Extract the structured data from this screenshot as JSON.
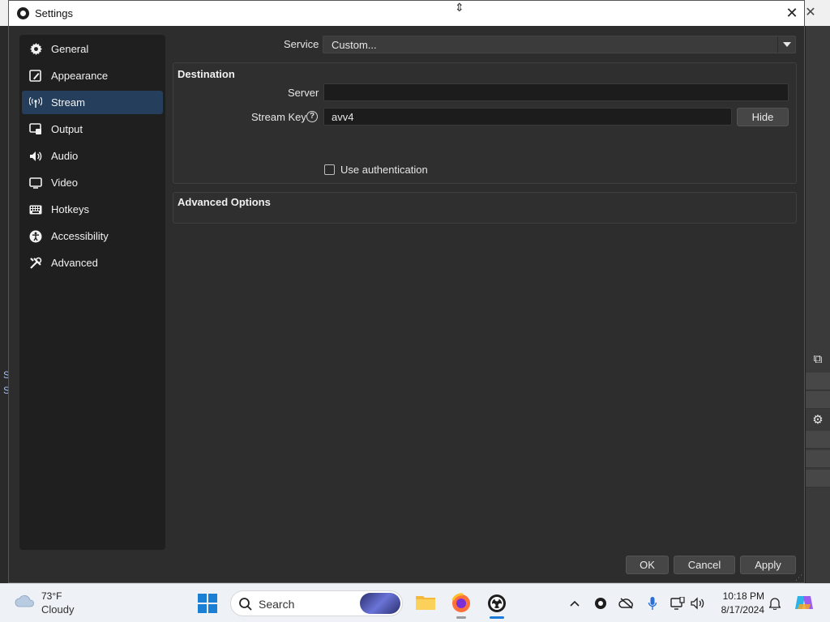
{
  "window": {
    "title": "Settings"
  },
  "sidebar": {
    "items": [
      {
        "label": "General",
        "icon": "gear-icon"
      },
      {
        "label": "Appearance",
        "icon": "paintbrush-icon"
      },
      {
        "label": "Stream",
        "icon": "antenna-icon",
        "active": true
      },
      {
        "label": "Output",
        "icon": "output-icon"
      },
      {
        "label": "Audio",
        "icon": "speaker-icon"
      },
      {
        "label": "Video",
        "icon": "monitor-icon"
      },
      {
        "label": "Hotkeys",
        "icon": "keyboard-icon"
      },
      {
        "label": "Accessibility",
        "icon": "accessibility-icon"
      },
      {
        "label": "Advanced",
        "icon": "tools-icon"
      }
    ]
  },
  "stream": {
    "service_label": "Service",
    "service_value": "Custom...",
    "destination_title": "Destination",
    "server_label": "Server",
    "server_value": "",
    "stream_key_label": "Stream Key",
    "stream_key_value": "avv4",
    "hide_button": "Hide",
    "use_auth_label": "Use authentication",
    "use_auth_checked": false,
    "advanced_title": "Advanced Options"
  },
  "buttons": {
    "ok": "OK",
    "cancel": "Cancel",
    "apply": "Apply"
  },
  "taskbar": {
    "weather_temp": "73°F",
    "weather_condition": "Cloudy",
    "search_placeholder": "Search",
    "time": "10:18 PM",
    "date": "8/17/2024"
  },
  "colors": {
    "accent_selected": "#253e5b",
    "dialog_bg": "#2d2d2d",
    "sidebar_bg": "#1f1f1f",
    "windows_blue": "#1b7fd4"
  }
}
